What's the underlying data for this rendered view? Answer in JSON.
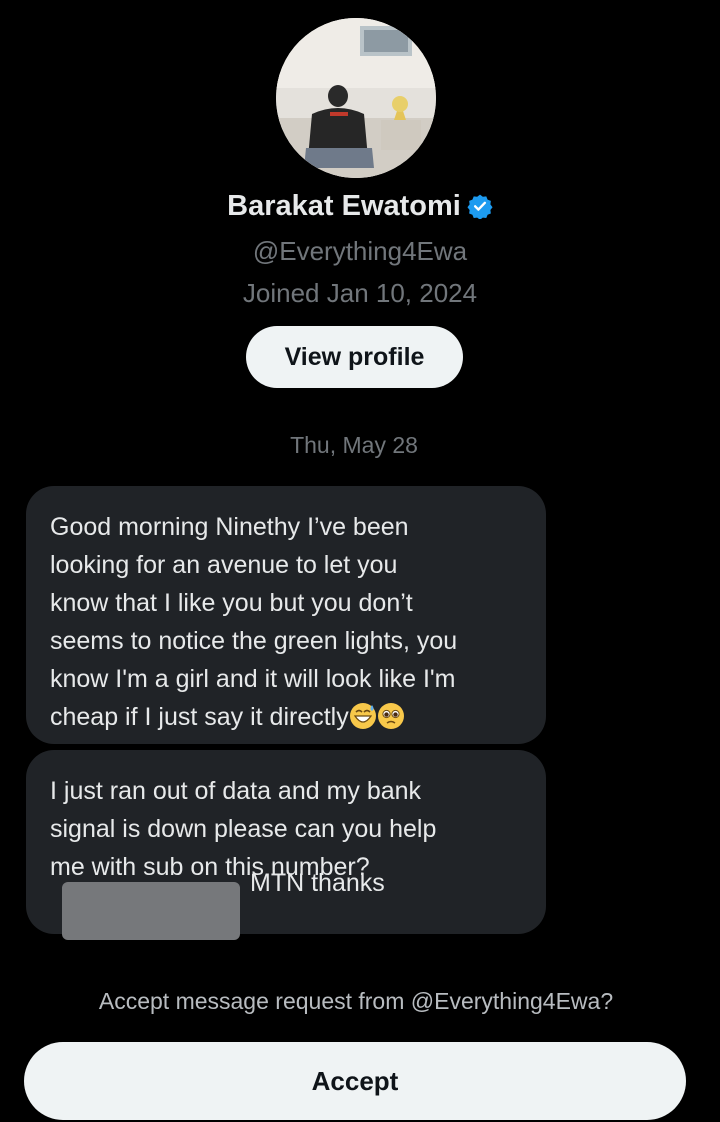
{
  "profile": {
    "display_name": "Barakat Ewatomi",
    "handle": "@Everything4Ewa",
    "joined": "Joined Jan 10, 2024",
    "view_profile_label": "View profile",
    "verified_color": "#1d9bf0"
  },
  "conversation": {
    "date": "Thu, May 28",
    "messages": [
      {
        "lines": [
          "Good morning Ninethy I’ve been",
          "looking for an avenue to let you",
          "know that I like you but you don’t",
          "seems to notice the green lights, you",
          "know I'm a girl and it will look like I'm",
          "cheap if I just say it directly"
        ],
        "emojis": [
          "grinning-sweat-emoji",
          "pleading-face-emoji"
        ]
      },
      {
        "lines": [
          "I just ran out of data and my bank",
          "signal is down please can you help",
          "me with sub on this number?",
          "MTN thanks"
        ]
      }
    ]
  },
  "request": {
    "prompt": "Accept message request from @Everything4Ewa?",
    "accept_label": "Accept"
  }
}
